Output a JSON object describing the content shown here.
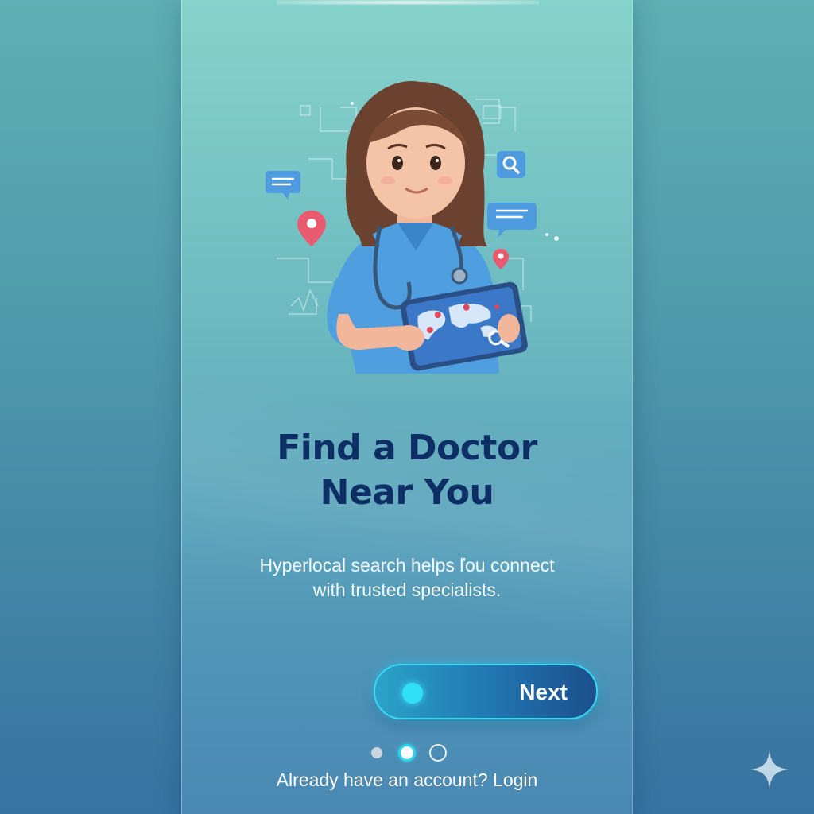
{
  "onboarding": {
    "title_line1": "Find a Doctor",
    "title_line2": "Near You",
    "subtitle_line1": "Hyperlocal search helps ľou connect",
    "subtitle_line2": "with trusted specialists.",
    "next_label": "Next",
    "login_prompt": "Already have an account? Login",
    "pagination": {
      "total": 3,
      "active": 2
    }
  },
  "icons": {
    "illustration": "doctor-with-map-tablet",
    "search": "search-icon",
    "chat": "chat-bubble-icon",
    "pin": "location-pin-icon",
    "sparkle": "sparkle-icon"
  },
  "colors": {
    "title": "#0e2f66",
    "accent": "#2fe0f8",
    "button_start": "#2aa3c9",
    "button_end": "#1c4f8c"
  }
}
